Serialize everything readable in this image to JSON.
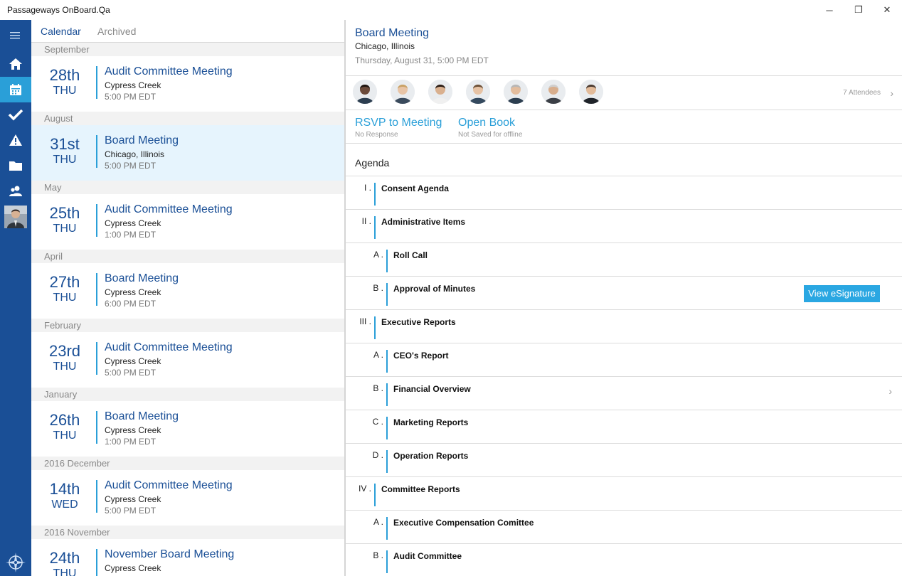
{
  "app": {
    "title": "Passageways OnBoard.Qa"
  },
  "window_controls": {
    "minimize": "─",
    "restore": "❐",
    "close": "✕"
  },
  "nav": {
    "items": [
      "menu-icon",
      "home-icon",
      "calendar-icon",
      "check-icon",
      "warning-icon",
      "folder-icon",
      "people-icon",
      "user-avatar"
    ],
    "active": "calendar-icon",
    "logo": "compass-logo-icon"
  },
  "tabs": {
    "calendar": "Calendar",
    "archived": "Archived"
  },
  "meetings": [
    {
      "month": "September",
      "day": "28th",
      "weekday": "THU",
      "name": "Audit Committee Meeting",
      "location": "Cypress Creek",
      "time": "5:00 PM EDT",
      "selected": false
    },
    {
      "month": "August",
      "day": "31st",
      "weekday": "THU",
      "name": "Board Meeting",
      "location": "Chicago, Illinois",
      "time": "5:00 PM EDT",
      "selected": true
    },
    {
      "month": "May",
      "day": "25th",
      "weekday": "THU",
      "name": "Audit Committee Meeting",
      "location": "Cypress Creek",
      "time": "1:00 PM EDT",
      "selected": false
    },
    {
      "month": "April",
      "day": "27th",
      "weekday": "THU",
      "name": "Board Meeting",
      "location": "Cypress Creek",
      "time": "6:00 PM EDT",
      "selected": false
    },
    {
      "month": "February",
      "day": "23rd",
      "weekday": "THU",
      "name": "Audit Committee Meeting",
      "location": "Cypress Creek",
      "time": "5:00 PM EDT",
      "selected": false
    },
    {
      "month": "January",
      "day": "26th",
      "weekday": "THU",
      "name": "Board Meeting",
      "location": "Cypress Creek",
      "time": "1:00 PM EDT",
      "selected": false
    },
    {
      "month": "2016 December",
      "day": "14th",
      "weekday": "WED",
      "name": "Audit Committee Meeting",
      "location": "Cypress Creek",
      "time": "5:00 PM EDT",
      "selected": false
    },
    {
      "month": "2016 November",
      "day": "24th",
      "weekday": "THU",
      "name": "November Board Meeting",
      "location": "Cypress Creek",
      "time": "",
      "selected": false
    }
  ],
  "detail": {
    "title": "Board Meeting",
    "location": "Chicago, Illinois",
    "datetime": "Thursday, August 31, 5:00 PM EDT",
    "attendees_label": "7 Attendees",
    "attendees": [
      {
        "skin": "#6b4a3a",
        "hair": "#1e1410",
        "suit": "#2c3e50"
      },
      {
        "skin": "#e8c4a6",
        "hair": "#c9a266",
        "suit": "#3a4a5c"
      },
      {
        "skin": "#d9b08f",
        "hair": "#2b1d16",
        "suit": "#f0f0f0"
      },
      {
        "skin": "#e6c2a4",
        "hair": "#6d5138",
        "suit": "#34495e"
      },
      {
        "skin": "#e3bd9e",
        "hair": "#b7b7b7",
        "suit": "#2c3e50"
      },
      {
        "skin": "#d8ae8d",
        "hair": "#cfcfcf",
        "suit": "#3b3f46"
      },
      {
        "skin": "#e2bb9a",
        "hair": "#4a3a30",
        "suit": "#1f2329"
      }
    ],
    "rsvp": {
      "label": "RSVP to Meeting",
      "status": "No Response"
    },
    "book": {
      "label": "Open Book",
      "status": "Not Saved for offline"
    },
    "agenda_title": "Agenda",
    "agenda": [
      {
        "num": "I .",
        "label": "Consent Agenda",
        "level": 0
      },
      {
        "num": "II .",
        "label": "Administrative Items",
        "level": 0
      },
      {
        "num": "A .",
        "label": "Roll Call",
        "level": 1
      },
      {
        "num": "B .",
        "label": "Approval of Minutes",
        "level": 1,
        "button": "View eSignature"
      },
      {
        "num": "III .",
        "label": "Executive Reports",
        "level": 0
      },
      {
        "num": "A .",
        "label": "CEO's Report",
        "level": 1
      },
      {
        "num": "B .",
        "label": "Financial Overview",
        "level": 1,
        "chevron": true
      },
      {
        "num": "C .",
        "label": "Marketing Reports",
        "level": 1
      },
      {
        "num": "D .",
        "label": "Operation Reports",
        "level": 1
      },
      {
        "num": "IV .",
        "label": "Committee Reports",
        "level": 0
      },
      {
        "num": "A .",
        "label": "Executive Compensation Comittee",
        "level": 1
      },
      {
        "num": "B .",
        "label": "Audit Committee",
        "level": 1
      }
    ]
  },
  "colors": {
    "nav": "#1a4f96",
    "accent": "#2a9fd8",
    "selected": "#e6f4fd",
    "button": "#2aa7e2"
  }
}
